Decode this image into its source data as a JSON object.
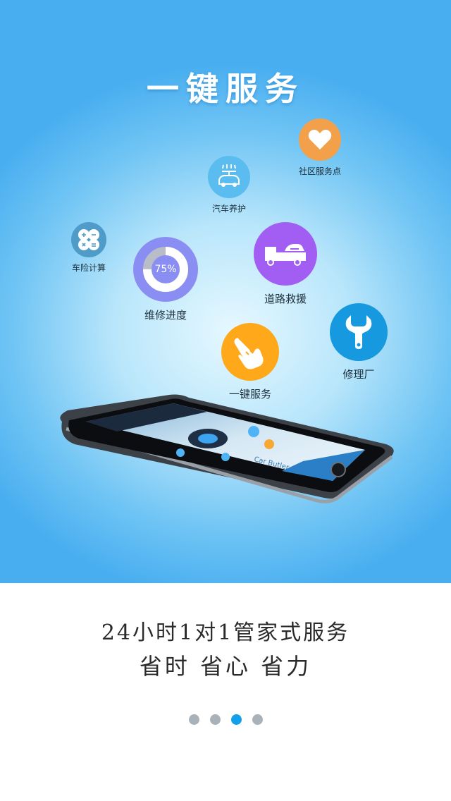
{
  "hero": {
    "title": "一键服务",
    "features": {
      "community": {
        "label": "社区服务点",
        "icon": "heart-icon",
        "color": "#f3a04a"
      },
      "car_care": {
        "label": "汽车养护",
        "icon": "car-wash-icon",
        "color": "#5bbcf0"
      },
      "insurance": {
        "label": "车险计算",
        "icon": "calculator-icon",
        "color": "#4f9cc9"
      },
      "repair_progress": {
        "label": "维修进度",
        "percent_text": "75%",
        "progress": 0.75,
        "icon": "progress-ring-icon",
        "color": "#8a8ef2"
      },
      "road_rescue": {
        "label": "道路救援",
        "icon": "tow-truck-icon",
        "color": "#a25ef2"
      },
      "one_key": {
        "label": "一键服务",
        "icon": "tap-hand-icon",
        "color": "#ffa81a"
      },
      "repair_shop": {
        "label": "修理厂",
        "icon": "wrench-icon",
        "color": "#1799e0"
      }
    },
    "phone": {
      "screen_caption": "Car Butler"
    }
  },
  "bottom": {
    "line1": "24小时1对1管家式服务",
    "line2": "省时 省心 省力"
  },
  "pager": {
    "count": 4,
    "active_index": 2
  }
}
